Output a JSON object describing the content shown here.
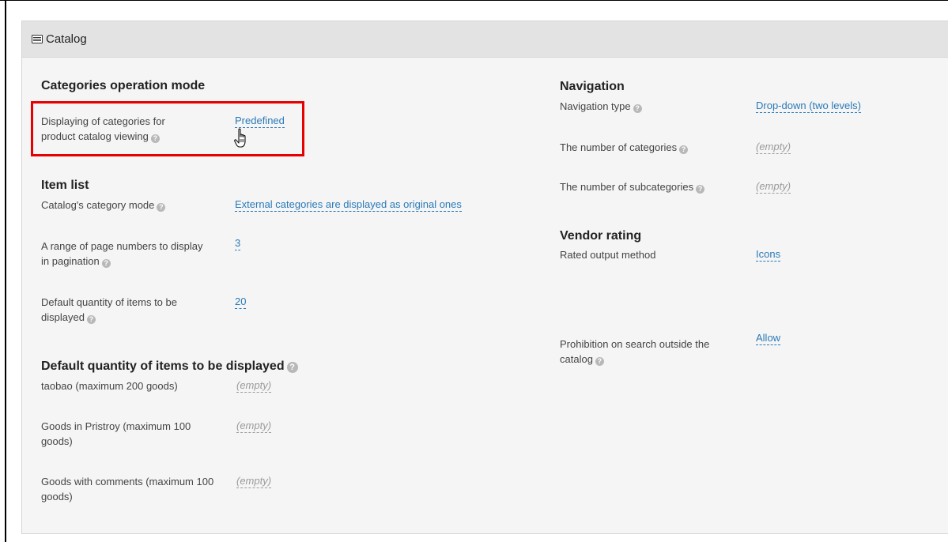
{
  "panel": {
    "title": "Catalog"
  },
  "left": {
    "categories_heading": "Categories operation mode",
    "displaying_label": "Displaying of categories for product catalog viewing",
    "displaying_value": "Predefined",
    "item_list_heading": "Item list",
    "category_mode_label": "Catalog's category mode",
    "category_mode_value": "External categories are displayed as original ones",
    "page_range_label": "A range of page numbers to display in pagination",
    "page_range_value": "3",
    "default_qty_label": "Default quantity of items to be displayed",
    "default_qty_value": "20",
    "default_qty_heading": "Default quantity of items to be displayed",
    "taobao_label": "taobao (maximum 200 goods)",
    "taobao_value": "(empty)",
    "pristroy_label": "Goods in Pristroy (maximum 100 goods)",
    "pristroy_value": "(empty)",
    "comments_label": "Goods with comments (maximum 100 goods)",
    "comments_value": "(empty)"
  },
  "right": {
    "navigation_heading": "Navigation",
    "nav_type_label": "Navigation type",
    "nav_type_value": "Drop-down (two levels)",
    "num_categories_label": "The number of categories",
    "num_categories_value": "(empty)",
    "num_subcategories_label": "The number of subcategories",
    "num_subcategories_value": "(empty)",
    "vendor_heading": "Vendor rating",
    "rated_label": "Rated output method",
    "rated_value": "Icons",
    "prohibition_label": "Prohibition on search outside the catalog",
    "prohibition_value": "Allow"
  },
  "icons": {
    "help": "?",
    "catalog": "catalog-list-icon",
    "cursor": "hand-pointer-icon"
  },
  "colors": {
    "link": "#2a7ab8",
    "highlight": "#e60000",
    "empty": "#9a9a9a",
    "header_bg": "#e3e3e3"
  }
}
